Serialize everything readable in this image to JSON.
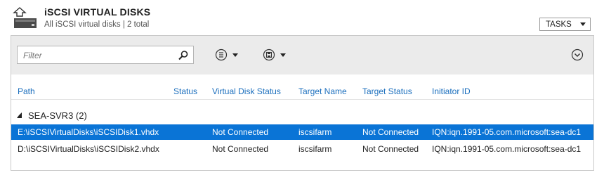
{
  "header": {
    "title": "iSCSI VIRTUAL DISKS",
    "subtitle": "All iSCSI virtual disks | 2 total",
    "tasks_label": "TASKS"
  },
  "toolbar": {
    "filter_placeholder": "Filter"
  },
  "table": {
    "columns": [
      "Path",
      "Status",
      "Virtual Disk Status",
      "Target Name",
      "Target Status",
      "Initiator ID"
    ],
    "group": "SEA-SVR3 (2)",
    "rows": [
      {
        "path": "E:\\iSCSIVirtualDisks\\iSCSIDisk1.vhdx",
        "status": "",
        "virtual_disk_status": "Not Connected",
        "target_name": "iscsifarm",
        "target_status": "Not Connected",
        "initiator_id": "IQN:iqn.1991-05.com.microsoft:sea-dc1",
        "selected": true
      },
      {
        "path": "D:\\iSCSIVirtualDisks\\iSCSIDisk2.vhdx",
        "status": "",
        "virtual_disk_status": "Not Connected",
        "target_name": "iscsifarm",
        "target_status": "Not Connected",
        "initiator_id": "IQN:iqn.1991-05.com.microsoft:sea-dc1",
        "selected": false
      }
    ]
  },
  "colors": {
    "header_link": "#1a6ebd",
    "selection": "#0a74d6",
    "toolbar_bg": "#ebebeb"
  },
  "icons": [
    "server-disk-icon",
    "search-icon",
    "list-options-icon",
    "save-icon",
    "expand-icon",
    "collapse-triangle-icon"
  ]
}
